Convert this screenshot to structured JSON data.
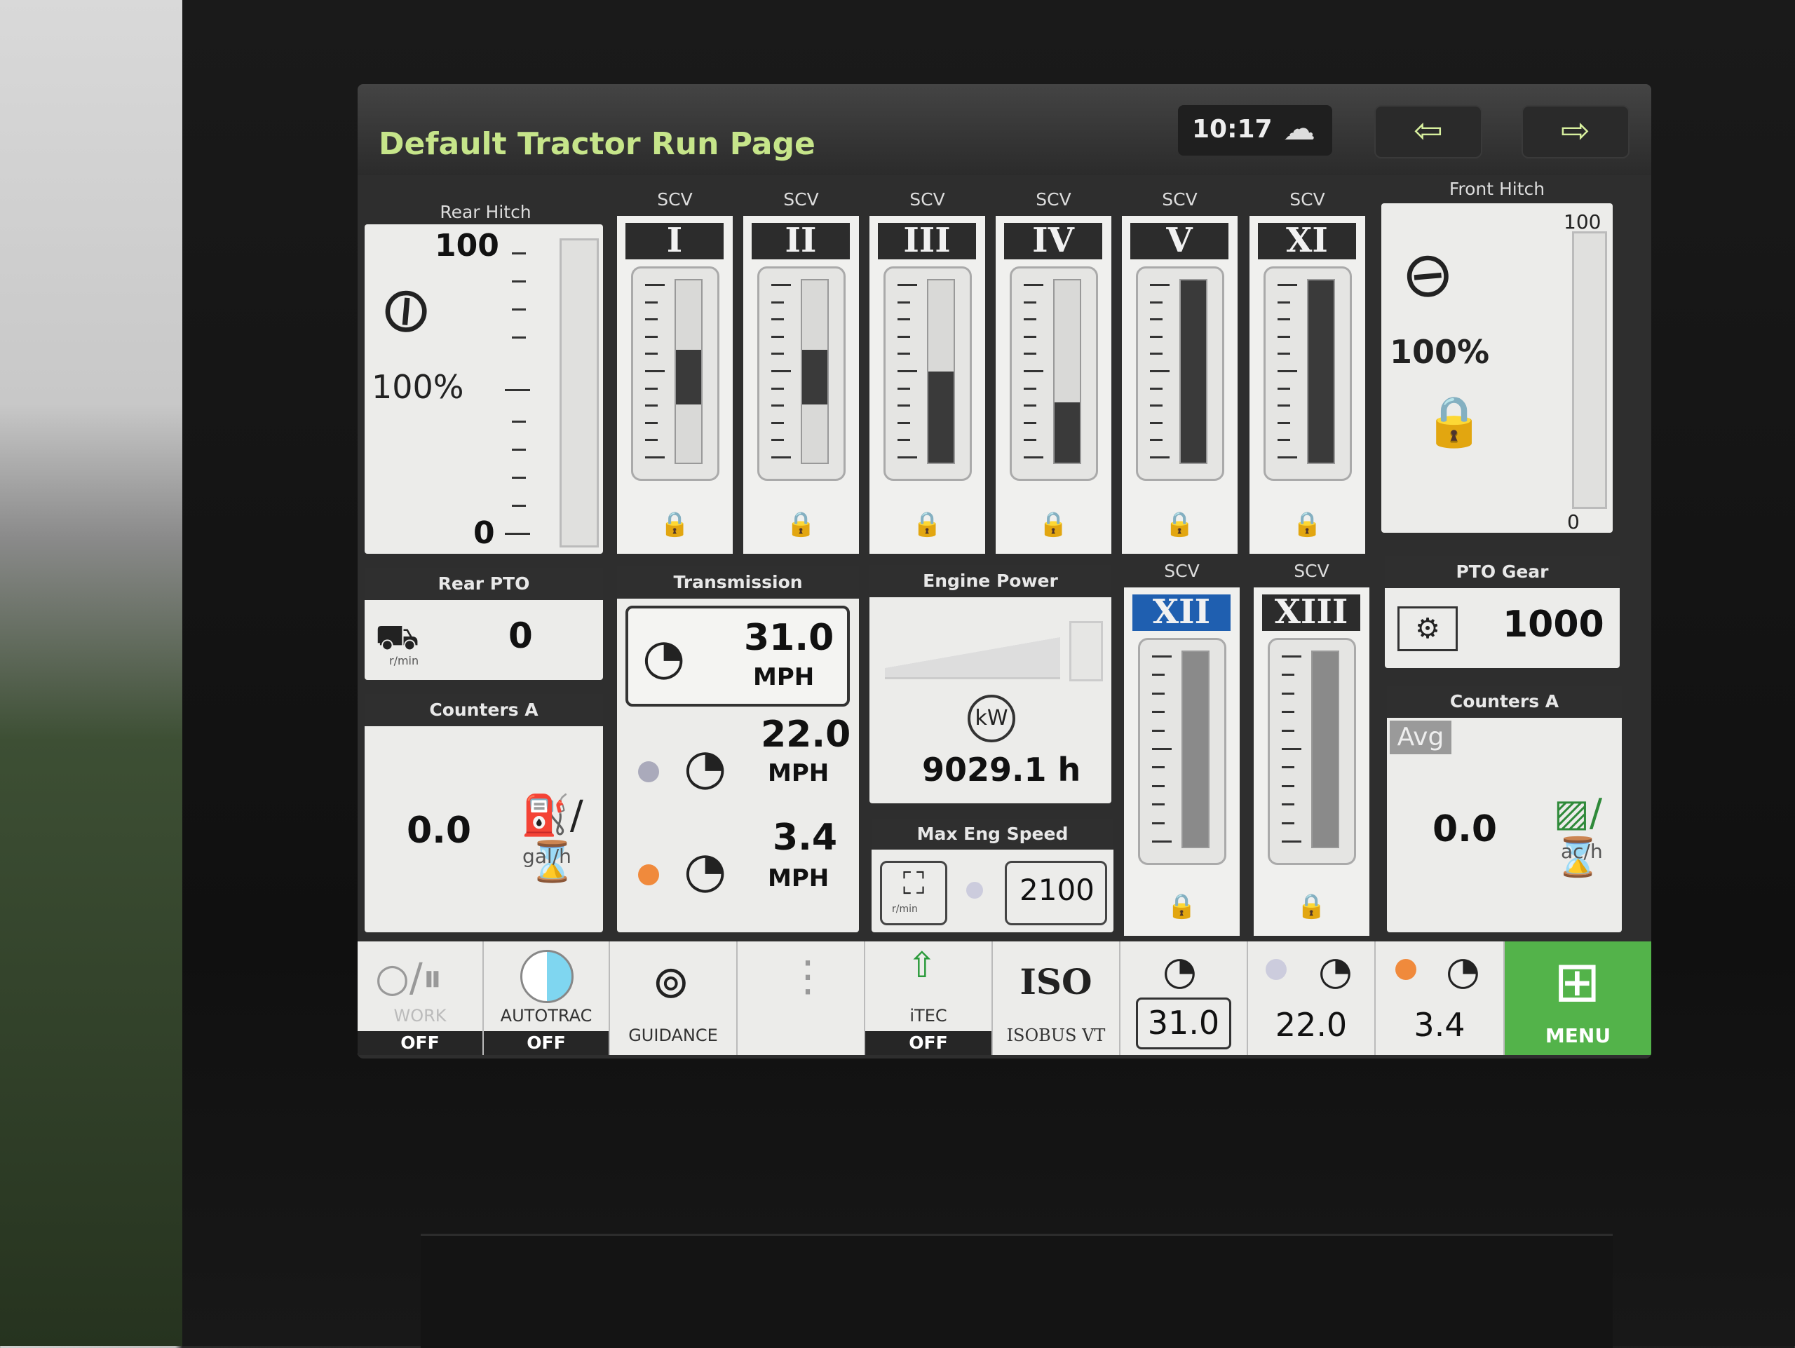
{
  "header": {
    "title": "Default Tractor Run Page",
    "time": "10:17",
    "cloud_icon": "cloud-alert-icon",
    "back_icon": "arrow-left-icon",
    "forward_icon": "arrow-right-icon"
  },
  "rear_hitch": {
    "label": "Rear Hitch",
    "max": "100",
    "min": "0",
    "percent": "100%",
    "level": 0.0
  },
  "scv_label": "SCV",
  "scvs": [
    {
      "roman": "I",
      "level": 0.3
    },
    {
      "roman": "II",
      "level": 0.3
    },
    {
      "roman": "III",
      "level": 0.5
    },
    {
      "roman": "IV",
      "level": 0.33
    },
    {
      "roman": "V",
      "level": 1.0
    },
    {
      "roman": "XI",
      "level": 1.0
    }
  ],
  "front_hitch": {
    "label": "Front Hitch",
    "max": "100",
    "min": "0",
    "percent": "100%"
  },
  "rear_pto": {
    "label": "Rear PTO",
    "value": "0",
    "unit": "r/min"
  },
  "counters_left": {
    "label": "Counters A",
    "value": "0.0",
    "unit": "gal/h"
  },
  "transmission": {
    "label": "Transmission",
    "set_speed": "31.0",
    "speed_2": "22.0",
    "speed_1": "3.4",
    "unit": "MPH"
  },
  "engine_power": {
    "label": "Engine Power",
    "hours": "9029.1 h",
    "unit_icon": "kW"
  },
  "max_eng_speed": {
    "label": "Max Eng Speed",
    "value": "2100",
    "unit": "r/min"
  },
  "scv_lower": [
    {
      "roman": "XII",
      "level": 1.0
    },
    {
      "roman": "XIII",
      "level": 1.0
    }
  ],
  "pto_gear": {
    "label": "PTO Gear",
    "value": "1000"
  },
  "counters_right": {
    "label": "Counters A",
    "avg": "Avg",
    "value": "0.0",
    "unit": "ac/h"
  },
  "bottom_bar": {
    "work": {
      "label": "WORK",
      "state": "OFF"
    },
    "autotrac": {
      "label": "AUTOTRAC",
      "state": "OFF"
    },
    "guidance": {
      "label": "GUIDANCE"
    },
    "itec": {
      "label": "iTEC",
      "state": "OFF"
    },
    "isobus": {
      "label": "ISOBUS VT",
      "logo": "ISO"
    },
    "speed_a": "31.0",
    "speed_b": "22.0",
    "speed_c": "3.4",
    "menu": "MENU"
  },
  "colors": {
    "title": "#c6e58a",
    "menu": "#53b34a",
    "scv_blue": "#1f5fb0"
  }
}
